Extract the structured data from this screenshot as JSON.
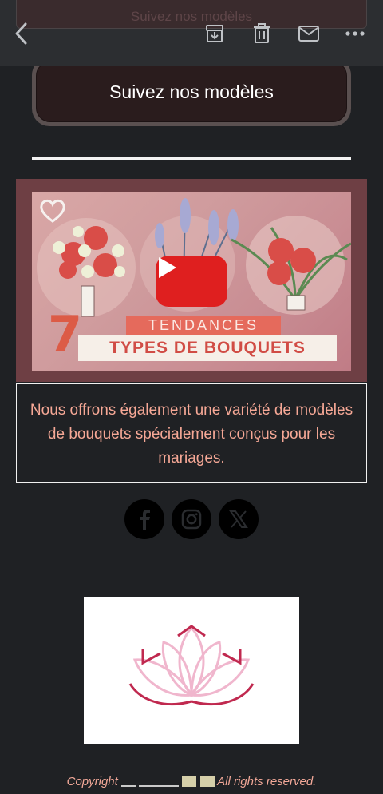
{
  "topbar": {
    "ghost_text": "Suivez nos modèles",
    "icons": [
      "back-arrow-icon",
      "archive-icon",
      "trash-icon",
      "mail-icon",
      "more-icon"
    ]
  },
  "follow_button": {
    "label": "Suivez nos modèles"
  },
  "video": {
    "tendances_label": "TENDANCES",
    "number": "7",
    "title": "TYPES DE BOUQUETS",
    "play_icon": "play-icon"
  },
  "description": "Nous offrons également une variété de modèles de bouquets spécialement conçus pour les mariages.",
  "social": [
    "facebook-icon",
    "instagram-icon",
    "x-icon"
  ],
  "footer": {
    "copyright": "Copyright",
    "rights": "All rights reserved."
  },
  "colors": {
    "background": "#1f2124",
    "accent_text": "#f6a896",
    "play_red": "#df1f1f"
  }
}
